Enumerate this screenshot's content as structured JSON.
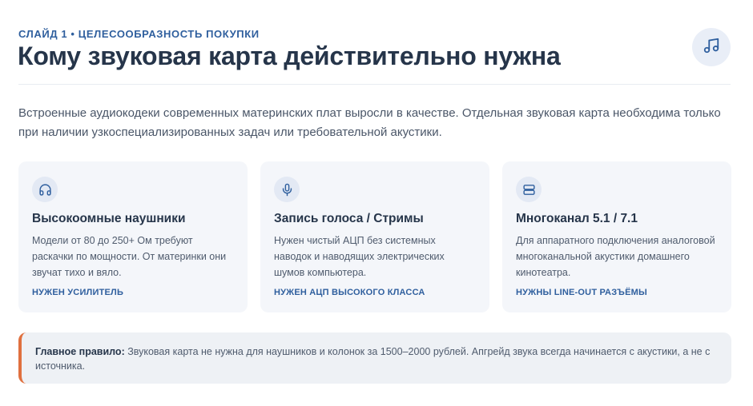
{
  "header": {
    "eyebrow": "СЛАЙД 1 • ЦЕЛЕСООБРАЗНОСТЬ ПОКУПКИ",
    "title": "Кому звуковая карта действительно нужна",
    "badge_icon": "music-note-icon"
  },
  "intro": "Встроенные аудиокодеки современных материнских плат выросли в качестве. Отдельная звуковая карта необходима только при наличии узкоспециализированных задач или требовательной акустики.",
  "cards": [
    {
      "icon": "headphones-icon",
      "title": "Высокоомные наушники",
      "text": "Модели от 80 до 250+ Ом требуют раскачки по мощности. От материнки они звучат тихо и вяло.",
      "tag": "НУЖЕН УСИЛИТЕЛЬ"
    },
    {
      "icon": "microphone-icon",
      "title": "Запись голоса / Стримы",
      "text": "Нужен чистый АЦП без системных наводок и наводящих электрических шумов компьютера.",
      "tag": "НУЖЕН АЦП ВЫСОКОГО КЛАССА"
    },
    {
      "icon": "multichannel-icon",
      "title": "Многоканал 5.1 / 7.1",
      "text": "Для аппаратного подключения аналоговой многоканальной акустики домашнего кинотеатра.",
      "tag": "НУЖНЫ LINE-OUT РАЗЪЁМЫ"
    }
  ],
  "rule": {
    "label": "Главное правило:",
    "text": " Звуковая карта не нужна для наушников и колонок за 1500–2000 рублей. Апгрейд звука всегда начинается с акустики, а не с источника."
  },
  "colors": {
    "accent": "#2f5f9e",
    "rule_border": "#e0703f",
    "card_bg": "#f4f6fa"
  }
}
